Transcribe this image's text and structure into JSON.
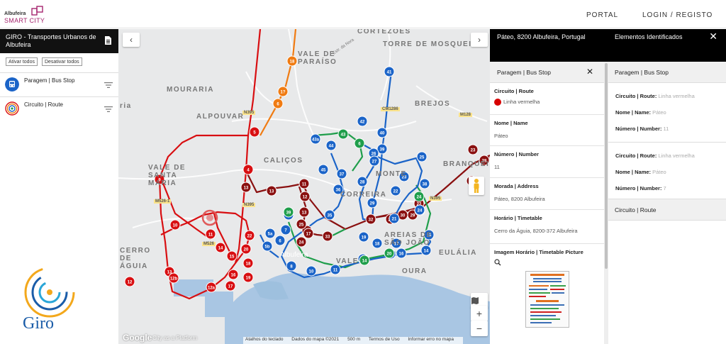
{
  "header": {
    "logo_top": "Albufeira",
    "logo_bottom": "SMART CITY",
    "nav_portal": "PORTAL",
    "nav_login": "LOGIN / REGISTO"
  },
  "left_panel": {
    "title": "GIRO - Transportes Urbanos de Albufeira",
    "activate_all": "Ativar todos",
    "deactivate_all": "Desativar todos",
    "layers": [
      {
        "label": "Paragem | Bus Stop",
        "icon": "bus-icon"
      },
      {
        "label": "Circuito | Route",
        "icon": "route-icon"
      }
    ],
    "brand": "Giro"
  },
  "map": {
    "place_labels": [
      "CORTEZÕES",
      "TORRE DE MOSQUEIRA",
      "VALE DE PARAÍSO",
      "MOURARIA",
      "ALPOUVAR",
      "BREJOS",
      "CALIÇOS",
      "VALE DE SANTA MARIA",
      "MONTE",
      "BRANQUEIRA",
      "CORREIRA",
      "AREIAS DE SÃO JOÃO",
      "CERRO DE ÁGUIA",
      "VALE",
      "OURA",
      "EULÁLIA",
      "ria",
      "Albufeira",
      "Estr. da Nora"
    ],
    "road_labels": [
      "N395",
      "CM1286",
      "M128",
      "M526-1",
      "N395",
      "M526",
      "N395"
    ],
    "route_colors": {
      "red": "#d80f12",
      "orange": "#f07b12",
      "darkred": "#8a1010",
      "green": "#1f9e4b",
      "blue": "#1b64c8",
      "teal": "#1f7f8a"
    },
    "stops": {
      "red": [
        "5",
        "4",
        "9",
        "10",
        "12",
        "13",
        "12b",
        "12a",
        "14",
        "15",
        "16",
        "17",
        "18",
        "19",
        "20",
        "22",
        "11"
      ],
      "orange": [
        "18",
        "1?",
        "6"
      ],
      "darkred": [
        "13",
        "13",
        "11",
        "12",
        "13",
        "16",
        "17",
        "33",
        "32",
        "30",
        "29",
        "31",
        "22",
        "23",
        "27",
        "28",
        "21",
        "24",
        "25"
      ],
      "blue": [
        "41",
        "42",
        "40",
        "43a",
        "44",
        "45",
        "39",
        "38",
        "26",
        "25",
        "23",
        "22",
        "24",
        "21",
        "27",
        "28",
        "29",
        "37",
        "36",
        "35",
        "34",
        "5a",
        "5b",
        "6",
        "7",
        "8",
        "10",
        "11",
        "12",
        "13",
        "14",
        "15",
        "16",
        "17",
        "18",
        "19"
      ],
      "green": [
        "43",
        "6",
        "39",
        "20",
        "14",
        "24"
      ]
    },
    "zoom_in": "+",
    "zoom_out": "−",
    "google": "Google",
    "city_platform": "City as a Platform",
    "attribution": [
      "Atalhos do teclado",
      "Dados do mapa ©2021",
      "500 m",
      "Termos de Uso",
      "Informar erro no mapa"
    ]
  },
  "right_panel": {
    "location": "Páteo, 8200 Albufeira, Portugal",
    "elements_title": "Elementos Identificados",
    "close": "✕",
    "detail": {
      "title": "Paragem | Bus Stop",
      "close": "✕",
      "route_label": "Circuito | Route",
      "route_value": "Linha vermelha",
      "name_label": "Nome | Name",
      "name_value": "Páteo",
      "number_label": "Número | Number",
      "number_value": "11",
      "address_label": "Morada | Address",
      "address_value": "Páteo, 8200 Albufeira",
      "timetable_label": "Horário | Timetable",
      "timetable_value": "Cerro da Águia, 8200-372 Albufeira",
      "picture_label": "Imagem Horário | Timetable Picture"
    },
    "summary": {
      "title": "Paragem | Bus Stop",
      "items": [
        {
          "route_key": "Circuito | Route:",
          "route_val": "Linha vermelha",
          "name_key": "Nome | Name:",
          "name_val": "Páteo",
          "num_key": "Número | Number:",
          "num_val": "11"
        },
        {
          "route_key": "Circuito | Route:",
          "route_val": "Linha vermelha",
          "name_key": "Nome | Name:",
          "name_val": "Páteo",
          "num_key": "Número | Number:",
          "num_val": "7"
        }
      ],
      "route_section": "Circuito | Route"
    }
  }
}
